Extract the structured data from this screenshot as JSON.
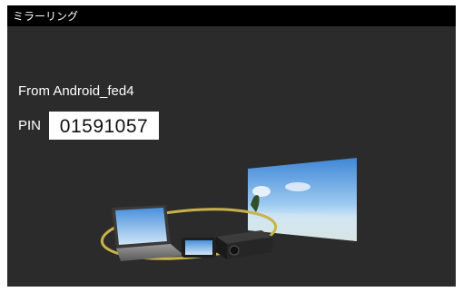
{
  "window": {
    "title": "ミラーリング"
  },
  "content": {
    "source_text": "From Android_fed4",
    "pin_label": "PIN",
    "pin_value": "01591057"
  },
  "colors": {
    "titlebar": "#000000",
    "background": "#2b2b2b",
    "ring": "#c9b24a"
  },
  "illustration": {
    "items": [
      "laptop-icon",
      "smartphone-icon",
      "projector-icon",
      "projection-screen-image",
      "connection-ring"
    ]
  }
}
